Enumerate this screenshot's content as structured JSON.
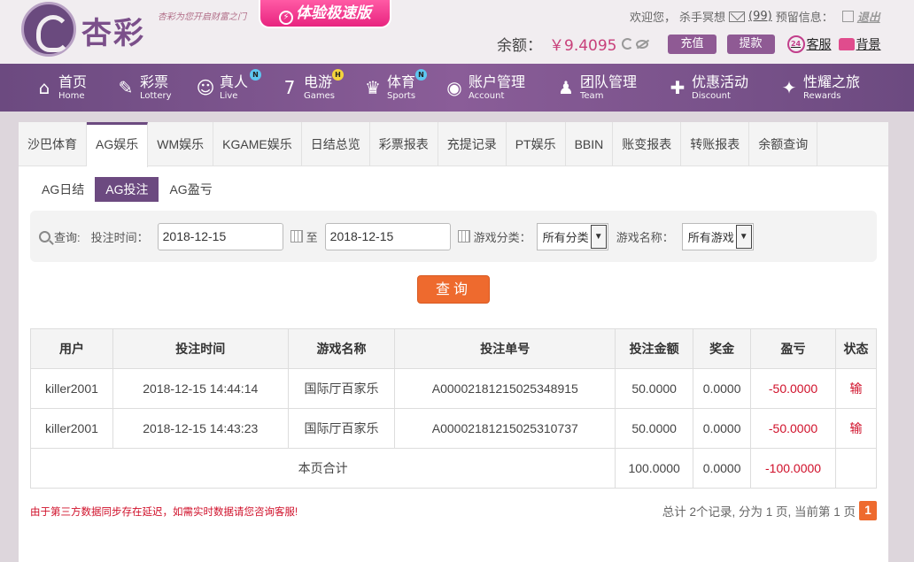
{
  "header": {
    "logo_text": "杏彩",
    "slogan": "杏彩为您开启财富之门",
    "promo_label": "体验极速版",
    "welcome_prefix": "欢迎您，",
    "username": "杀手冥想",
    "mail_count": "(99)",
    "alert_label": "预留信息：",
    "logout_label": "退出",
    "balance_label": "余额：",
    "balance_amount": "￥9.4095",
    "deposit_label": "充值",
    "withdraw_label": "提款",
    "service_label": "客服",
    "service_icon_text": "24",
    "background_label": "背景"
  },
  "nav": {
    "items": [
      {
        "cn": "首页",
        "en": "Home",
        "icon": "home-icon",
        "glyph": "⌂"
      },
      {
        "cn": "彩票",
        "en": "Lottery",
        "icon": "ticket-icon",
        "glyph": "✎"
      },
      {
        "cn": "真人",
        "en": "Live",
        "icon": "dealer-icon",
        "glyph": "☺",
        "badge": "N"
      },
      {
        "cn": "电游",
        "en": "Games",
        "icon": "slot-seven-icon",
        "glyph": "7",
        "badge": "H"
      },
      {
        "cn": "体育",
        "en": "Sports",
        "icon": "trophy-icon",
        "glyph": "♛",
        "badge": "N"
      },
      {
        "cn": "账户管理",
        "en": "Account",
        "icon": "account-icon",
        "glyph": "◉"
      },
      {
        "cn": "团队管理",
        "en": "Team",
        "icon": "team-icon",
        "glyph": "♟"
      },
      {
        "cn": "优惠活动",
        "en": "Discount",
        "icon": "gift-icon",
        "glyph": "✚"
      },
      {
        "cn": "性耀之旅",
        "en": "Rewards",
        "icon": "rewards-icon",
        "glyph": "✦"
      }
    ]
  },
  "tabs": {
    "items": [
      "沙巴体育",
      "AG娱乐",
      "WM娱乐",
      "KGAME娱乐",
      "日结总览",
      "彩票报表",
      "充提记录",
      "PT娱乐",
      "BBIN",
      "账变报表",
      "转账报表",
      "余额查询"
    ],
    "active": 1
  },
  "subtabs": {
    "items": [
      "AG日结",
      "AG投注",
      "AG盈亏"
    ],
    "active": 1
  },
  "query": {
    "label": "查询:",
    "time_label": "投注时间：",
    "start_date": "2018-12-15",
    "to_label": "至",
    "end_date": "2018-12-15",
    "category_label": "游戏分类：",
    "category_value": "所有分类",
    "game_label": "游戏名称：",
    "game_value": "所有游戏",
    "button_label": "查询"
  },
  "table": {
    "headers": [
      "用户",
      "投注时间",
      "游戏名称",
      "投注单号",
      "投注金额",
      "奖金",
      "盈亏",
      "状态"
    ],
    "rows": [
      [
        "killer2001",
        "2018-12-15 14:44:14",
        "国际厅百家乐",
        "A00002181215025348915",
        "50.0000",
        "0.0000",
        "-50.0000",
        "输"
      ],
      [
        "killer2001",
        "2018-12-15 14:43:23",
        "国际厅百家乐",
        "A00002181215025310737",
        "50.0000",
        "0.0000",
        "-50.0000",
        "输"
      ]
    ],
    "summary": {
      "label": "本页合计",
      "amount": "100.0000",
      "bonus": "0.0000",
      "profit": "-100.0000"
    }
  },
  "footer": {
    "notice": "由于第三方数据同步存在延迟，如需实时数据请您咨询客服!",
    "pager_text": "总计 2个记录, 分为 1 页, 当前第 1 页",
    "current_page": "1"
  },
  "colors": {
    "brand_purple": "#6c4a80",
    "accent_orange": "#ee6a2e",
    "loss_red": "#d0102a",
    "balance_pink": "#c8407a"
  }
}
